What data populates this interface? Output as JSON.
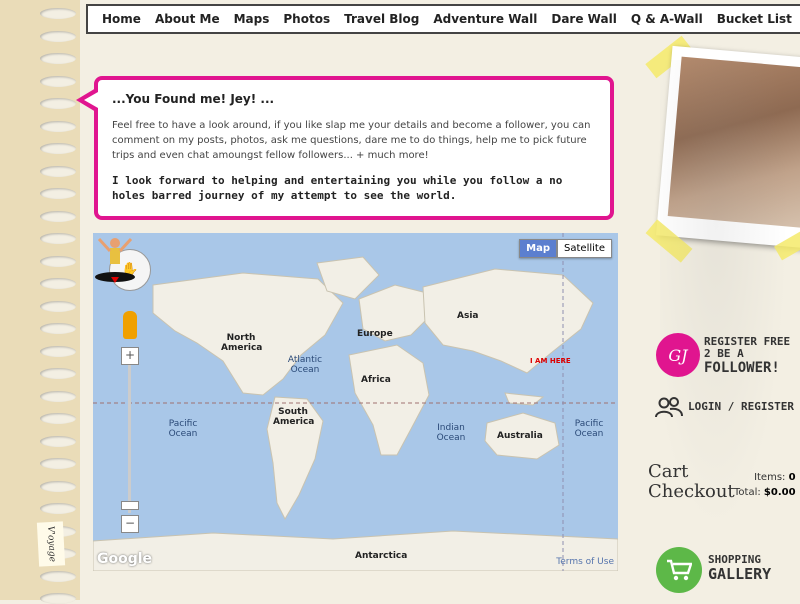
{
  "nav": {
    "items": [
      "Home",
      "About Me",
      "Maps",
      "Photos",
      "Travel Blog",
      "Adventure Wall",
      "Dare Wall",
      "Q & A-Wall",
      "Bucket List"
    ]
  },
  "bubble": {
    "title": "...You Found me! Jey! ...",
    "body": "Feel free to have a look around, if you like slap me your details and become a follower, you can comment on my posts, photos, ask me questions, dare me to do things, help me to pick future trips and even chat amoungst fellow followers... + much more!",
    "strong": "I look forward to helping and entertaining you while you follow a no holes barred journey of my attempt to see the world."
  },
  "map": {
    "map_label": "Map",
    "satellite_label": "Satellite",
    "zoom_in": "+",
    "zoom_out": "−",
    "google": "Google",
    "terms": "Terms of Use",
    "marker_label": "I AM HERE",
    "labels": {
      "north_america": "North America",
      "europe": "Europe",
      "asia": "Asia",
      "africa": "Africa",
      "south_america": "South America",
      "australia": "Australia",
      "antarctica": "Antarctica",
      "atlantic": "Atlantic Ocean",
      "pacific_left": "Pacific Ocean",
      "pacific_right": "Pacific Ocean",
      "indian": "Indian Ocean"
    }
  },
  "side_tag": "V'oyage",
  "register": {
    "badge": "GJ",
    "line1": "REGISTER FREE",
    "line2": "2 BE A",
    "line3": "FOLLOWER!"
  },
  "login": {
    "text": "LOGIN / REGISTER"
  },
  "cart": {
    "title_line1": "Cart",
    "title_line2": "Checkout",
    "items_label": "Items:",
    "items_value": "0",
    "total_label": "Total:",
    "total_value": "$0.00"
  },
  "shop": {
    "line1": "SHOPPING",
    "line2": "GALLERY"
  },
  "colors": {
    "accent": "#e0158f",
    "shop": "#5db848",
    "map_water": "#a9c7e8",
    "map_land": "#f2efe6"
  }
}
